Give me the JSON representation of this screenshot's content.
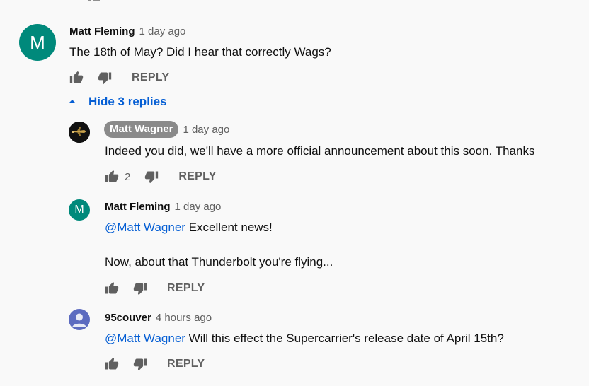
{
  "colors": {
    "accent": "#065fd4",
    "avatar_teal": "#00897b",
    "avatar_purple": "#5c6bc0",
    "pill_gray": "#8a8a8a"
  },
  "comment": {
    "avatar_letter": "M",
    "author": "Matt Fleming",
    "time": "1 day ago",
    "text": "The 18th of May?  Did I hear that correctly Wags?",
    "reply_label": "REPLY",
    "hide_replies_label": "Hide 3 replies"
  },
  "replies": [
    {
      "author": "Matt Wagner",
      "time": "1 day ago",
      "text": "Indeed you did, we'll have a more official announcement about this soon. Thanks",
      "likes": "2",
      "reply_label": "REPLY"
    },
    {
      "avatar_letter": "M",
      "author": "Matt Fleming",
      "time": "1 day ago",
      "mention": "@Matt Wagner",
      "text_line1": " Excellent news!",
      "text_line2": "Now, about that Thunderbolt you're flying...",
      "reply_label": "REPLY"
    },
    {
      "author": "95couver",
      "time": "4 hours ago",
      "mention": "@Matt Wagner",
      "text": " Will this effect the Supercarrier's release date of April 15th?",
      "reply_label": "REPLY"
    }
  ]
}
